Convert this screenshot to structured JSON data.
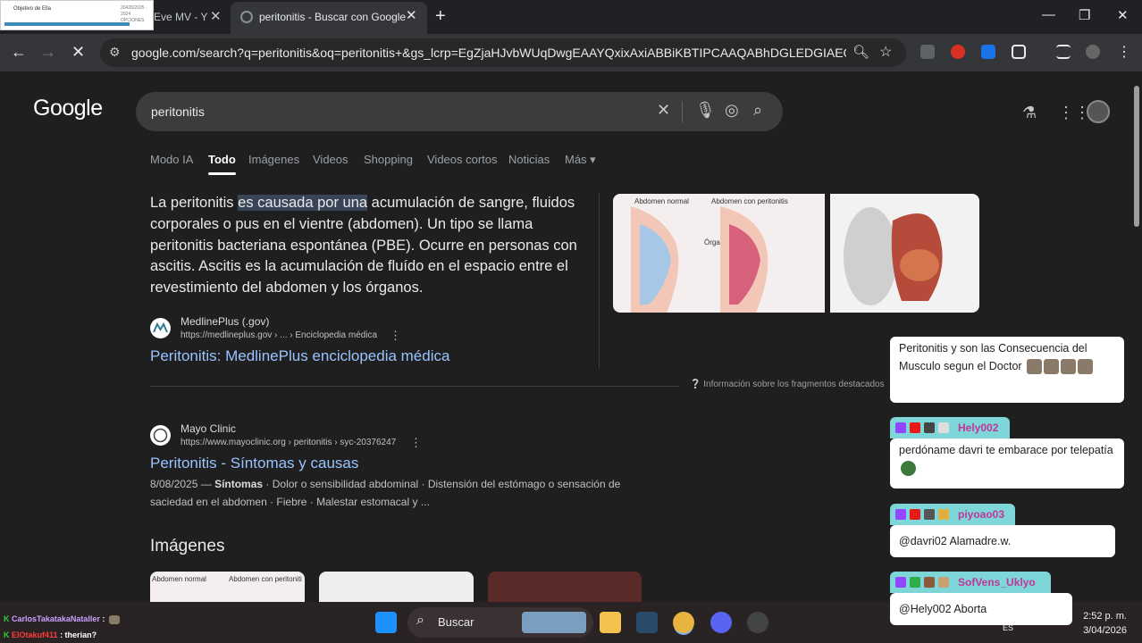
{
  "browser": {
    "tabs": [
      {
        "label": "Eve MV - Y"
      },
      {
        "label": "peritonitis - Buscar con Google"
      }
    ],
    "thumbnail_title": "Objetivo de Ella",
    "thumbnail_meta": "20426/2025 · 2024 OPCIONES",
    "url": "google.com/search?q=peritonitis&oq=peritonitis+&gs_lcrp=EgZjaHJvbWUqDwgEAAYQxixAxiABBiKBTIPCAAQABhDGLEDGIAEGIoFMgc..."
  },
  "google": {
    "logo": "Google",
    "query": "peritonitis",
    "tabs": [
      "Modo IA",
      "Todo",
      "Imágenes",
      "Videos",
      "Shopping",
      "Videos cortos",
      "Noticias",
      "Más"
    ],
    "snippet": {
      "before": "La peritonitis ",
      "highlight": "es causada por una",
      "after": " acumulación de sangre, fluidos corporales o pus en el vientre (abdomen). Un tipo se llama peritonitis bacteriana espontánea (PBE). Ocurre en personas con ascitis. Ascitis es la acumulación de fluído en el espacio entre el revestimiento del abdomen y los órganos."
    },
    "featured_source": {
      "site": "MedlinePlus (.gov)",
      "url": "https://medlineplus.gov › ... › Enciclopedia médica",
      "link": "Peritonitis: MedlinePlus enciclopedia médica"
    },
    "image_labels": {
      "normal": "Abdomen normal",
      "peritonitis": "Abdomen con peritonitis",
      "organs": "Órganos"
    },
    "info": "Información sobre los fragmentos destacados",
    "result2": {
      "site": "Mayo Clinic",
      "url": "https://www.mayoclinic.org › peritonitis › syc-20376247",
      "link": "Peritonitis - Síntomas y causas",
      "date": "8/08/2025",
      "bold": "Síntomas",
      "desc": " · Dolor o sensibilidad abdominal · Distensión del estómago o sensación de saciedad en el abdomen · Fiebre · Malestar estomacal y ..."
    },
    "images_heading": "Imágenes"
  },
  "chat": {
    "messages": [
      {
        "user": "",
        "text": "Peritonitis y son las Consecuencia del Musculo segun el Doctor"
      },
      {
        "user": "Hely002",
        "text": "perdóname davri te embarace por telepatía"
      },
      {
        "user": "piyoao03",
        "text": "@davri02 Alamadre.w."
      },
      {
        "user": "SofVens_Uklyo",
        "text": "@Hely002 Aborta"
      }
    ],
    "overlay_lines": [
      {
        "user": "CarlosTakatakaNataller",
        "text": ":"
      },
      {
        "user": "ElOtakuf411",
        "text": ": therian?"
      }
    ]
  },
  "taskbar": {
    "search_label": "Buscar",
    "lang": "ES",
    "time": "2:52 p. m.",
    "date": "3/04/2026"
  },
  "colors": {
    "accent": "#99c3ff",
    "highlight": "#394457",
    "chat_name": "#7fd6d8"
  }
}
